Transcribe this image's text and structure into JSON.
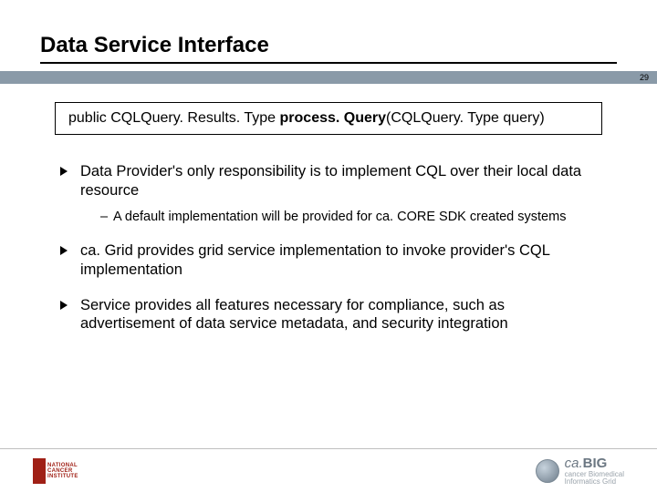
{
  "title": "Data Service Interface",
  "page_number": "29",
  "code_box": {
    "prefix": "public CQLQuery. Results. Type ",
    "bold": "process. Query",
    "suffix": "(CQLQuery. Type query)"
  },
  "bullets": {
    "b1": "Data Provider's only responsibility is to implement CQL over their local data resource",
    "b1_sub1": "A default implementation will be provided for ca. CORE SDK created systems",
    "b2": "ca. Grid provides grid service implementation to invoke provider's CQL implementation",
    "b3": "Service provides all features necessary for compliance, such as advertisement of data service metadata, and security integration"
  },
  "footer": {
    "nci_line1": "NATIONAL",
    "nci_line2": "CANCER",
    "nci_line3": "INSTITUTE",
    "cabig_prefix": "ca.",
    "cabig_big": "BIG",
    "cabig_sub1": "cancer Biomedical",
    "cabig_sub2": "Informatics Grid"
  }
}
